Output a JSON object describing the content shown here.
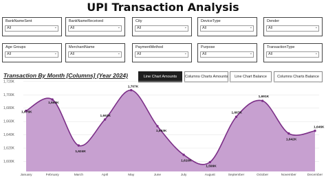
{
  "page": {
    "title": "UPI Transaction Analysis"
  },
  "slicers": [
    {
      "label": "BankNameSent",
      "value": "All"
    },
    {
      "label": "BankNameReceived",
      "value": "All"
    },
    {
      "label": "City",
      "value": "All"
    },
    {
      "label": "DeviceType",
      "value": "All"
    },
    {
      "label": "Dender",
      "value": "All"
    },
    {
      "label": "Age Groups",
      "value": "All"
    },
    {
      "label": "MerchantName",
      "value": "All"
    },
    {
      "label": "PaymentMethod",
      "value": "All"
    },
    {
      "label": "Purpose",
      "value": "All"
    },
    {
      "label": "TransactionType",
      "value": "All"
    }
  ],
  "buttons": [
    {
      "label": "Line Chart Amounts",
      "active": true
    },
    {
      "label": "Columns Charts Amounts",
      "active": false
    },
    {
      "label": "Line Chart Balance",
      "active": false
    },
    {
      "label": "Columns Charts Balance",
      "active": false
    }
  ],
  "colors": {
    "line": "#7b2e87",
    "fill": "#c7a0d0",
    "active_button": "#1f1f1f"
  },
  "chart_data": {
    "type": "area",
    "title": "Transaction By Month [Columns] (Year 2024)",
    "categories": [
      "January",
      "February",
      "March",
      "April",
      "May",
      "June",
      "July",
      "August",
      "September",
      "October",
      "November",
      "December"
    ],
    "values": [
      1676,
      1693,
      1624,
      1663,
      1707,
      1653,
      1610,
      1599,
      1667,
      1691,
      1642,
      1646
    ],
    "data_labels": [
      "1,676K",
      "1,693K",
      "1,624K",
      "1,663K",
      "1,707K",
      "1,653K",
      "1,610K",
      "1,599K",
      "1,667K",
      "1,691K",
      "1,642K",
      "1,646K"
    ],
    "y_ticks": [
      1600,
      1620,
      1640,
      1660,
      1680,
      1700,
      1720
    ],
    "y_tick_labels": [
      "1,600K",
      "1,620K",
      "1,640K",
      "1,660K",
      "1,680K",
      "1,700K",
      "1,720K"
    ],
    "ylim": [
      1585,
      1725
    ],
    "grid": true,
    "legend": "none"
  }
}
